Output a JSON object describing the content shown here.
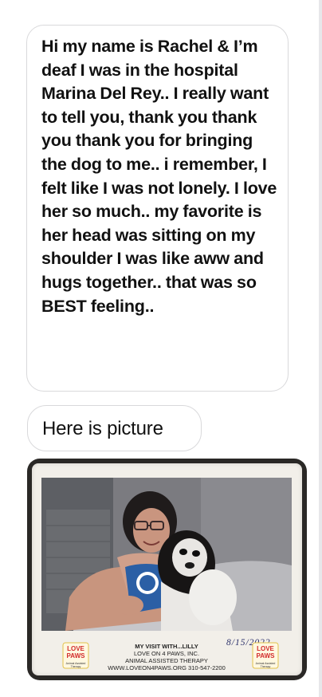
{
  "messages": [
    {
      "text": "Hi my name is Rachel & I’m deaf I was in the hospital Marina Del Rey.. I really want to tell you, thank you thank you thank you for bringing the dog to me.. i remember, I felt like I was not lonely. I love her so much.. my favorite is her head was sitting on my shoulder I was like aww and hugs together.. that was so BEST feeling.."
    },
    {
      "text": "Here is picture"
    }
  ],
  "photo": {
    "caption_title": "MY VISIT WITH...LILLY",
    "caption_org": "LOVE ON 4 PAWS, INC.",
    "caption_program": "ANIMAL ASSISTED THERAPY",
    "caption_contact": "WWW.LOVEON4PAWS.ORG 310-547-2200",
    "handwritten_date": "8/15/2022",
    "logo_line1": "LOVE",
    "logo_line2": "4",
    "logo_line3": "PAWS",
    "logo_sub": "Animal Assisted Therapy"
  },
  "colors": {
    "bubble_bg": "#ffffff",
    "bubble_border": "#d9d9db",
    "text": "#111111",
    "logo_red": "#d22b2b"
  }
}
